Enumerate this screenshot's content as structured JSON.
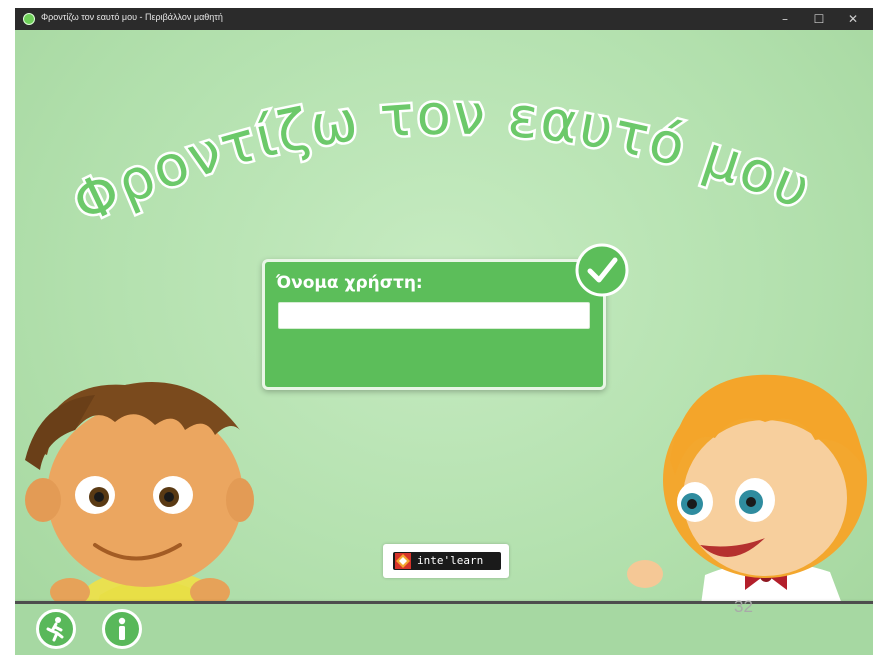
{
  "window": {
    "title": "Φροντίζω τον εαυτό μου - Περιβάλλον μαθητή",
    "minimize_glyph": "–",
    "maximize_glyph": "☐",
    "close_glyph": "✕"
  },
  "app": {
    "title": "Φροντίζω τον εαυτό μου",
    "login": {
      "label": "Όνομα χρήστη:",
      "username_value": "",
      "confirm_icon": "checkmark-icon"
    },
    "bottom_bar": {
      "exit_icon": "running-figure-icon",
      "info_icon": "info-icon"
    },
    "logo_text": "inte'learn"
  },
  "page_number": "32",
  "colors": {
    "background": "#b4e0b0",
    "accent_green": "#5cbe5a",
    "title_text": "#6cc96a"
  }
}
